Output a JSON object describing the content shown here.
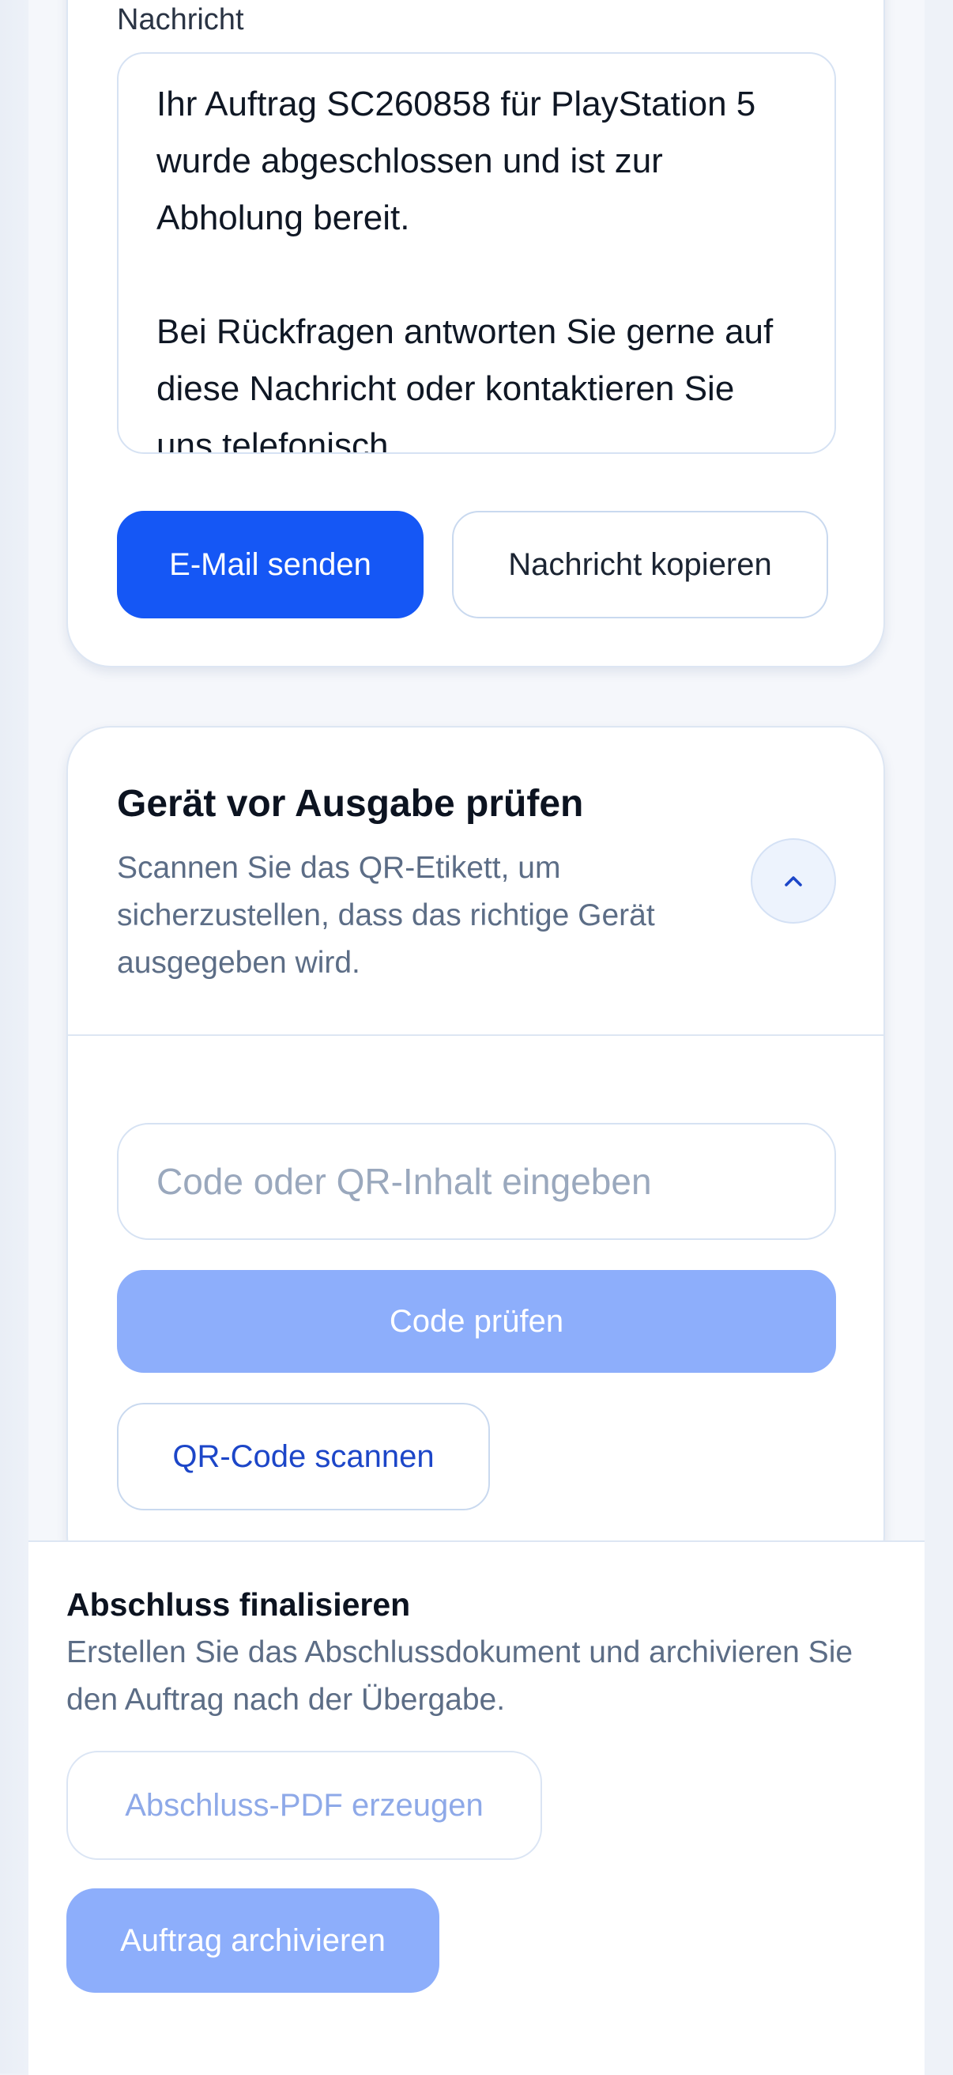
{
  "message_card": {
    "label": "Nachricht",
    "message_text": "Ihr Auftrag SC260858 für PlayStation 5 wurde abgeschlossen und ist zur Abholung bereit.\n\nBei Rückfragen antworten Sie gerne auf diese Nachricht oder kontaktieren Sie uns telefonisch.",
    "send_email_label": "E-Mail senden",
    "copy_message_label": "Nachricht kopieren"
  },
  "device_check": {
    "title": "Gerät vor Ausgabe prüfen",
    "description": "Scannen Sie das QR-Etikett, um sicherzustellen, dass das richtige Gerät ausgegeben wird.",
    "collapse_icon": "chevron-up-icon",
    "code_placeholder": "Code oder QR-Inhalt eingeben",
    "check_code_label": "Code prüfen",
    "scan_qr_label": "QR-Code scannen"
  },
  "finalize": {
    "title": "Abschluss finalisieren",
    "description": "Erstellen Sie das Abschlussdokument und archivieren Sie den Auftrag nach der Übergabe.",
    "create_pdf_label": "Abschluss-PDF erzeugen",
    "archive_label": "Auftrag archivieren"
  },
  "colors": {
    "primary": "#1557f5",
    "primary_disabled": "#8daefb",
    "link_blue": "#1c46c8"
  }
}
